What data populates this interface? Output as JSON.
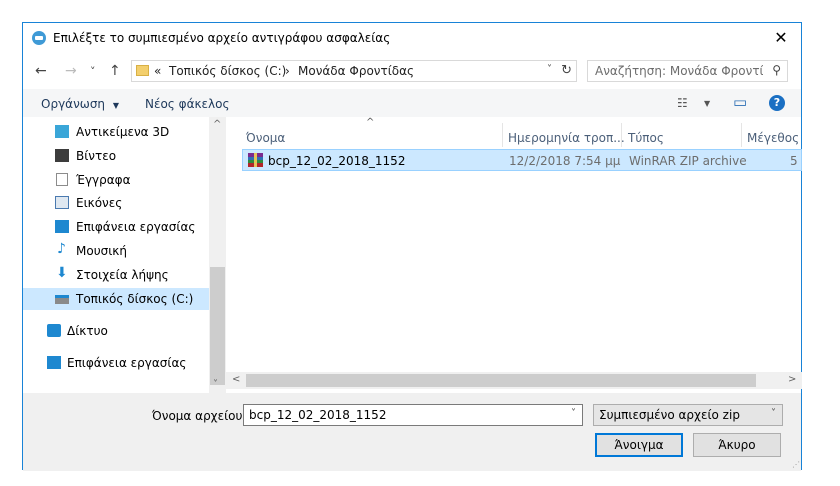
{
  "window": {
    "title": "Επιλέξτε το συμπιεσμένο αρχείο αντιγράφου ασφαλείας",
    "close_glyph": "✕"
  },
  "nav": {
    "back": "←",
    "forward": "→",
    "recent": "˅",
    "up": "↑",
    "address_prefix": "«",
    "address_segments": [
      "Τοπικός δίσκος (C:)",
      "›",
      "Μονάδα Φροντίδας"
    ],
    "dropdown_glyph": "˅",
    "refresh_glyph": "↻",
    "search_placeholder": "Αναζήτηση: Μονάδα Φροντί...",
    "search_glyph": "⚲"
  },
  "toolbar": {
    "organize": "Οργάνωση",
    "organize_glyph": "▼",
    "new_folder": "Νέος φάκελος",
    "view_glyph": "☷",
    "view_drop_glyph": "▼",
    "pane_glyph": "▭",
    "help_glyph": "?"
  },
  "sidebar": {
    "items": [
      {
        "label": "Αντικείμενα 3D",
        "icon": "3d-objects-icon",
        "color": "#3aa6d8"
      },
      {
        "label": "Βίντεο",
        "icon": "video-icon",
        "color": "#3c3c3c"
      },
      {
        "label": "Έγγραφα",
        "icon": "documents-icon",
        "color": "#8c8c8c"
      },
      {
        "label": "Εικόνες",
        "icon": "pictures-icon",
        "color": "#4a7ab0"
      },
      {
        "label": "Επιφάνεια εργασίας",
        "icon": "desktop-icon",
        "color": "#1e88d0"
      },
      {
        "label": "Μουσική",
        "icon": "music-icon",
        "color": "#1e88d0"
      },
      {
        "label": "Στοιχεία λήψης",
        "icon": "downloads-icon",
        "color": "#1e88d0"
      },
      {
        "label": "Τοπικός δίσκος (C:)",
        "icon": "local-disk-icon",
        "color": "#6d6d6d"
      },
      {
        "label": "Δίκτυο",
        "icon": "network-icon",
        "color": "#1e88d0"
      },
      {
        "label": "Επιφάνεια εργασίας",
        "icon": "desktop-icon",
        "color": "#1e88d0"
      }
    ],
    "scroll_up": "^",
    "scroll_down": "˅"
  },
  "files": {
    "columns": [
      "Όνομα",
      "Ημερομηνία τροπ...",
      "Τύπος",
      "Μέγεθος"
    ],
    "sort_glyph": "^",
    "rows": [
      {
        "name": "bcp_12_02_2018_1152",
        "date": "12/2/2018 7:54 μμ",
        "type": "WinRAR ZIP archive",
        "size": "5"
      }
    ],
    "scroll_left": "<",
    "scroll_right": ">"
  },
  "footer": {
    "filename_label": "Όνομα αρχείου:",
    "filename_value": "bcp_12_02_2018_1152",
    "filename_drop": "˅",
    "filetype_value": "Συμπιεσμένο αρχείο zip",
    "filetype_drop": "˅",
    "open_label": "Άνοιγμα",
    "cancel_label": "Άκυρο",
    "grip_glyph": "⋰"
  },
  "colors": {
    "accent": "#0078d7",
    "selection": "#cce8ff",
    "link_text": "#1e395b"
  }
}
